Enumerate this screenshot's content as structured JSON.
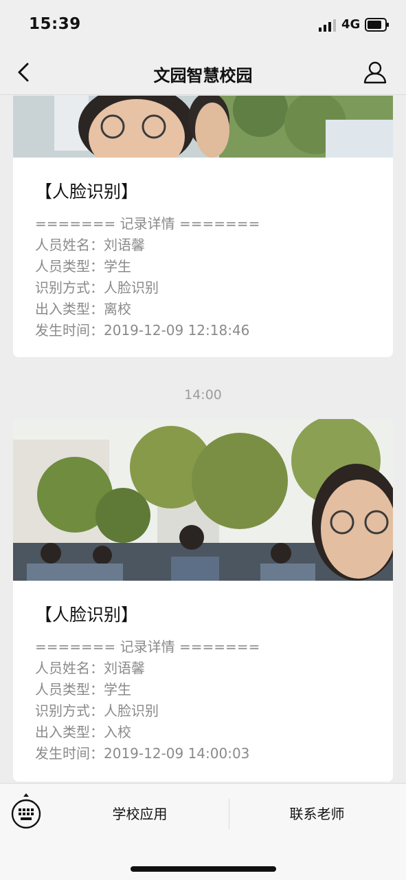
{
  "status_bar": {
    "time": "15:39",
    "network": "4G"
  },
  "nav": {
    "title": "文园智慧校园",
    "back_icon": "chevron-left-icon",
    "profile_icon": "person-icon"
  },
  "records": [
    {
      "title": "【人脸识别】",
      "photo_alt": "face capture photo",
      "details": [
        "======= 记录详情 =======",
        "人员姓名：刘语馨",
        "人员类型：学生",
        "识别方式：人脸识别",
        "出入类型：离校",
        "发生时间：2019-12-09 12:18:46"
      ]
    },
    {
      "title": "【人脸识别】",
      "photo_alt": "face capture photo",
      "details": [
        "======= 记录详情 =======",
        "人员姓名：刘语馨",
        "人员类型：学生",
        "识别方式：人脸识别",
        "出入类型：入校",
        "发生时间：2019-12-09 14:00:03"
      ]
    }
  ],
  "time_divider": "14:00",
  "bottom_menu": {
    "keyboard_icon": "keyboard-icon",
    "items": [
      "学校应用",
      "联系老师"
    ]
  },
  "colors": {
    "background": "#ededed",
    "card": "#ffffff",
    "detail_text": "#8a8a8a",
    "title_text": "#111111"
  }
}
